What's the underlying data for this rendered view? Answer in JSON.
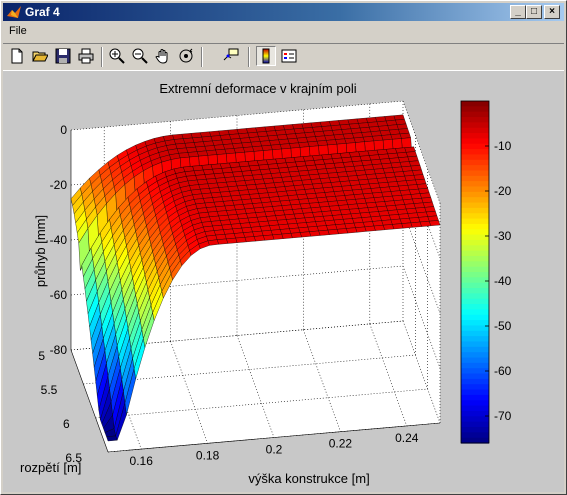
{
  "window": {
    "title": "Graf 4",
    "minimize_label": "_",
    "maximize_label": "□",
    "close_label": "×"
  },
  "menu": {
    "items": [
      "File"
    ]
  },
  "toolbar": {
    "tools": [
      {
        "name": "new-figure-icon"
      },
      {
        "name": "open-file-icon"
      },
      {
        "name": "save-icon"
      },
      {
        "name": "print-icon"
      },
      {
        "name": "zoom-in-icon"
      },
      {
        "name": "zoom-out-icon"
      },
      {
        "name": "pan-hand-icon"
      },
      {
        "name": "rotate-3d-icon"
      },
      {
        "name": "data-cursor-icon"
      },
      {
        "name": "colorbar-icon"
      },
      {
        "name": "legend-icon"
      }
    ]
  },
  "chart_data": {
    "type": "surface",
    "title": "Extremní deformace v krajním poli",
    "xlabel": "výška konstrukce [m]",
    "ylabel": "rozpětí [m]",
    "zlabel": "průhyb [mm]",
    "x_ticks": [
      "0.16",
      "0.18",
      "0.2",
      "0.22",
      "0.24"
    ],
    "y_ticks": [
      "5",
      "5.5",
      "6",
      "6.5"
    ],
    "z_ticks": [
      "0",
      "-20",
      "-40",
      "-60",
      "-80"
    ],
    "xlim": [
      0.15,
      0.25
    ],
    "ylim": [
      5,
      6.5
    ],
    "zlim": [
      -80,
      0
    ],
    "colorbar": {
      "ticks": [
        "-10",
        "-20",
        "-30",
        "-40",
        "-50",
        "-60",
        "-70"
      ],
      "range": [
        -76,
        0
      ],
      "colormap": "jet"
    },
    "surface_description_values": {
      "x": [
        0.15,
        0.16,
        0.17,
        0.18,
        0.19,
        0.2,
        0.21,
        0.22,
        0.23,
        0.24,
        0.25
      ],
      "y": [
        5.0,
        5.25,
        5.5,
        5.75,
        6.0,
        6.25,
        6.5
      ],
      "z_min": -76,
      "z_max": -3
    }
  }
}
